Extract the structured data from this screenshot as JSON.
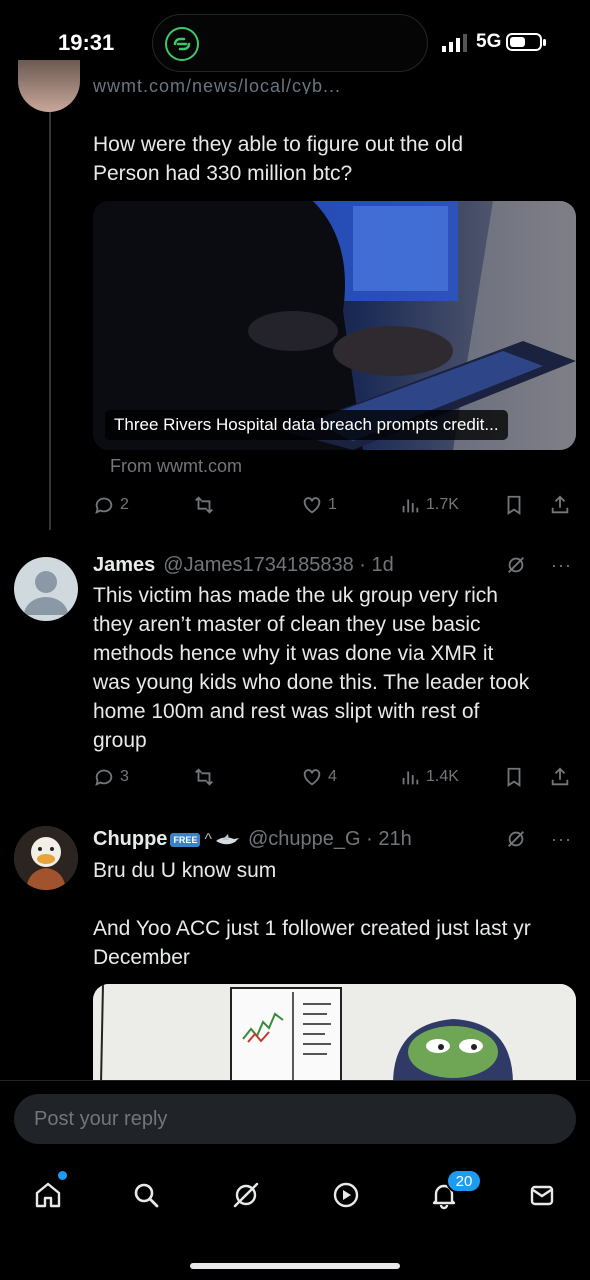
{
  "status_bar": {
    "time": "19:31",
    "network": "5G",
    "battery_level": 0.55
  },
  "top_post": {
    "link_text": "wwmt.com/news/local/cyb...",
    "text_line1": "How were they able to figure out the old",
    "text_line2": "Person had 330 million btc?",
    "card_title": "Three Rivers Hospital data breach prompts credit...",
    "card_source": "From wwmt.com",
    "stats": {
      "replies": "2",
      "likes": "1",
      "views": "1.7K"
    }
  },
  "reply1": {
    "name": "James",
    "handle": "@James1734185838 · 1d",
    "lines": [
      "This victim has made the uk group very rich",
      "they aren’t master of clean they use basic",
      "methods hence why it was done via XMR it",
      "was young kids who done this. The leader took",
      "home 100m and rest was slipt with rest of",
      "group"
    ],
    "stats": {
      "replies": "3",
      "likes": "4",
      "views": "1.4K"
    },
    "more": "···"
  },
  "reply2": {
    "name": "Chuppe",
    "badge": "FREE",
    "extra": "^",
    "handle": "@chuppe_G · 21h",
    "line1": "Bru du U know sum",
    "line2": "And Yoo ACC just 1 follower created just last yr",
    "line3": "December",
    "more": "···"
  },
  "composer": {
    "placeholder": "Post your reply"
  },
  "nav": {
    "notifications_badge": "20"
  },
  "colors": {
    "accent": "#1d9bf0",
    "muted": "#71767b",
    "background": "#000000",
    "text": "#e7e9ea"
  }
}
